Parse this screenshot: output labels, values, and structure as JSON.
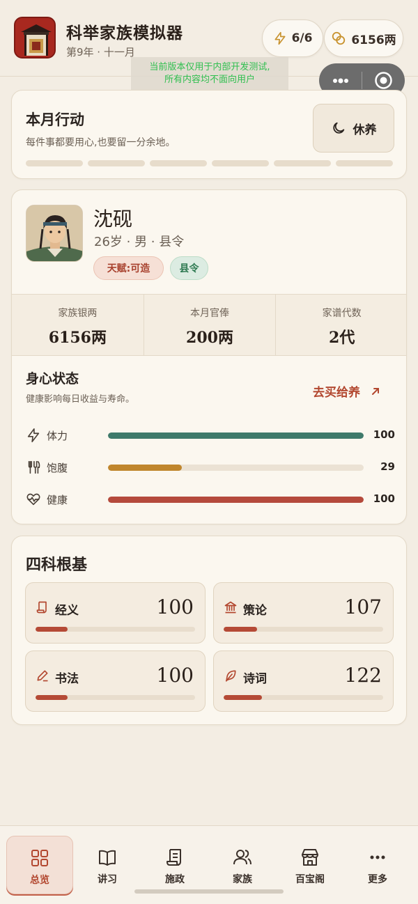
{
  "app": {
    "title": "科举家族模拟器",
    "subtitle": "第9年 · 十一月",
    "energy": "6/6",
    "money": "6156两",
    "notice_line1": "当前版本仅用于内部开发测试,",
    "notice_line2": "所有内容均不面向用户"
  },
  "monthly_action": {
    "title": "本月行动",
    "desc": "每件事都要用心,也要留一分余地。",
    "rest_label": "休养",
    "slots": 6
  },
  "profile": {
    "name": "沈砚",
    "meta": "26岁 · 男 · 县令",
    "tag_talent": "天赋:可造",
    "tag_post": "县令"
  },
  "stats": [
    {
      "label": "家族银两",
      "value": "6156两"
    },
    {
      "label": "本月官俸",
      "value": "200两"
    },
    {
      "label": "家谱代数",
      "value": "2代"
    }
  ],
  "body_state": {
    "title": "身心状态",
    "desc": "健康影响每日收益与寿命。",
    "buy_label": "去买给养",
    "bars": [
      {
        "label": "体力",
        "value": "100",
        "fraction": 1.0,
        "color": "#3e7a6b",
        "icon": "lightning-icon"
      },
      {
        "label": "饱腹",
        "value": "29",
        "fraction": 0.29,
        "color": "#c0862d",
        "icon": "utensils-icon"
      },
      {
        "label": "健康",
        "value": "100",
        "fraction": 1.0,
        "color": "#b54a3c",
        "icon": "heart-pulse-icon"
      }
    ]
  },
  "subjects": {
    "title": "四科根基",
    "items": [
      {
        "label": "经义",
        "value": "100",
        "fraction": 0.2,
        "icon": "scroll-icon"
      },
      {
        "label": "策论",
        "value": "107",
        "fraction": 0.21,
        "icon": "institution-icon"
      },
      {
        "label": "书法",
        "value": "100",
        "fraction": 0.2,
        "icon": "pen-icon"
      },
      {
        "label": "诗词",
        "value": "122",
        "fraction": 0.24,
        "icon": "feather-icon"
      }
    ]
  },
  "nav": {
    "items": [
      {
        "label": "总览",
        "icon": "grid-icon",
        "active": true
      },
      {
        "label": "讲习",
        "icon": "book-icon",
        "active": false
      },
      {
        "label": "施政",
        "icon": "scroll-icon",
        "active": false
      },
      {
        "label": "家族",
        "icon": "people-icon",
        "active": false
      },
      {
        "label": "百宝阁",
        "icon": "shop-icon",
        "active": false
      },
      {
        "label": "更多",
        "icon": "more-icon",
        "active": false
      }
    ]
  },
  "colors": {
    "accent": "#b2472f",
    "background": "#f3ede3",
    "card": "#fbf7ef"
  }
}
